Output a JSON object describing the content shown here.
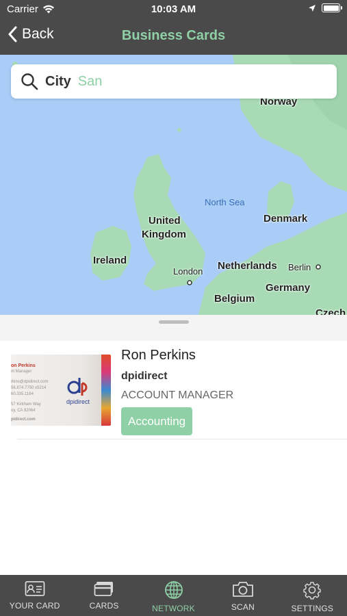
{
  "status_bar": {
    "carrier": "Carrier",
    "time": "10:03 AM"
  },
  "nav": {
    "back_label": "Back",
    "title": "Business Cards"
  },
  "search": {
    "field_label": "City",
    "value": "San"
  },
  "map": {
    "labels": {
      "norway": "Norway",
      "north_sea": "North Sea",
      "united_kingdom_1": "United",
      "united_kingdom_2": "Kingdom",
      "denmark": "Denmark",
      "ireland": "Ireland",
      "london": "London",
      "netherlands": "Netherlands",
      "berlin": "Berlin",
      "germany": "Germany",
      "belgium": "Belgium",
      "czech": "Czech"
    }
  },
  "contacts": [
    {
      "name": "Ron Perkins",
      "company": "dpidirect",
      "title": "ACCOUNT MANAGER",
      "tag": "Accounting",
      "card_text": {
        "line1": "on Perkins",
        "line2": "nt Manager",
        "line3": "rkins@dpidirect.com",
        "line4": "56.874.7750 x5214",
        "line5": "60.335.1164",
        "line6": "57 Kirkham Way",
        "line7": "oy, CA 92064",
        "line8": "pidirect.com",
        "logo_text": "dpidirect"
      }
    }
  ],
  "tabs": [
    {
      "label": "YOUR CARD",
      "icon": "id-card-icon"
    },
    {
      "label": "CARDS",
      "icon": "cards-icon"
    },
    {
      "label": "NETWORK",
      "icon": "globe-icon",
      "active": true
    },
    {
      "label": "SCAN",
      "icon": "camera-icon"
    },
    {
      "label": "SETTINGS",
      "icon": "gear-icon"
    }
  ],
  "colors": {
    "accent": "#8fd0a6",
    "bar": "#4a4a4a",
    "water": "#a9cdf7",
    "land": "#a8dbb5"
  }
}
